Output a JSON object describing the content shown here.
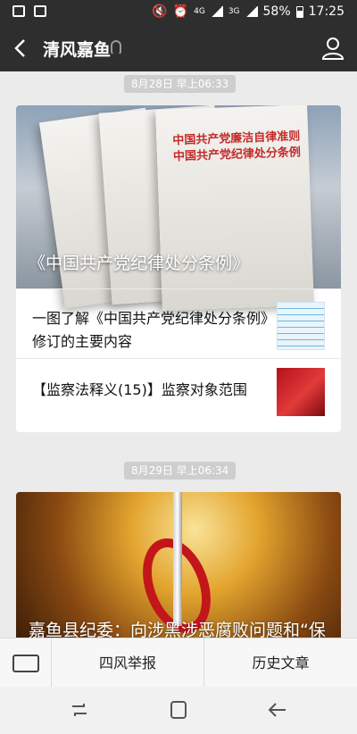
{
  "status_bar": {
    "network": "4G",
    "network_extra": "3G",
    "battery": "58%",
    "time": "17:25"
  },
  "header": {
    "title": "清风嘉鱼"
  },
  "feed": [
    {
      "date": "8月28日 早上06:33",
      "hero_caption": "《中国共产党纪律处分条例》",
      "hero_book_text": [
        "中国共产党廉洁自律准则",
        "中国共产党纪律处分条例"
      ],
      "articles": [
        {
          "title": "一图了解《中国共产党纪律处分条例》修订的主要内容"
        },
        {
          "title": "【监察法释义(15)】监察对象范围"
        }
      ]
    },
    {
      "date": "8月29日 早上06:34",
      "hero_caption": "嘉鱼县纪委：向涉黑涉恶腐败问题和“保"
    }
  ],
  "bottom_menu": {
    "items": [
      "四风举报",
      "历史文章"
    ]
  },
  "colors": {
    "header_bg": "#2e2e2e",
    "page_bg": "#ebebeb",
    "book_red": "#c62a2a"
  }
}
